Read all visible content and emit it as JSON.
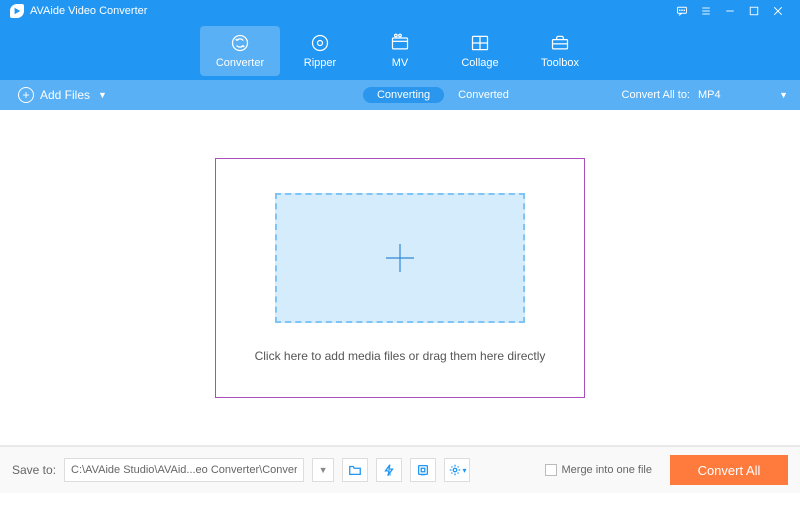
{
  "title": "AVAide Video Converter",
  "nav": {
    "items": [
      {
        "label": "Converter"
      },
      {
        "label": "Ripper"
      },
      {
        "label": "MV"
      },
      {
        "label": "Collage"
      },
      {
        "label": "Toolbox"
      }
    ]
  },
  "actionbar": {
    "add_files_label": "Add Files",
    "tab_converting": "Converting",
    "tab_converted": "Converted",
    "convert_all_to_label": "Convert All to:",
    "convert_all_to_value": "MP4"
  },
  "dropzone": {
    "text": "Click here to add media files or drag them here directly"
  },
  "bottom": {
    "save_to_label": "Save to:",
    "save_to_path": "C:\\AVAide Studio\\AVAid...eo Converter\\Converted",
    "merge_label": "Merge into one file",
    "convert_all_button": "Convert All"
  }
}
